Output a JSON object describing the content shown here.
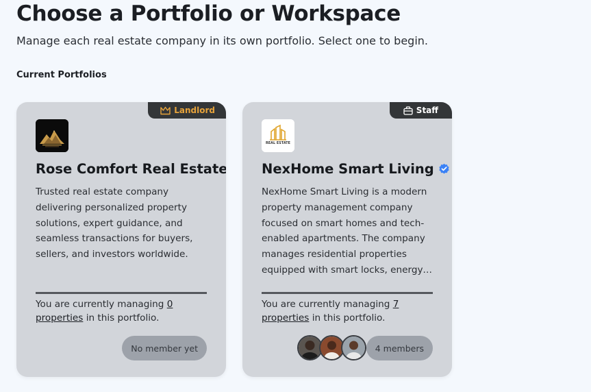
{
  "header": {
    "title": "Choose a Portfolio or Workspace",
    "subtitle": "Manage each real estate company in its own portfolio. Select one to begin."
  },
  "section_label": "Current Portfolios",
  "colors": {
    "page_bg": "#f4f8fd",
    "card_bg": "#d2d5da",
    "badge_bg": "#333638",
    "landlord_accent": "#e7a33b",
    "verified_blue": "#3b82f6",
    "pill_bg": "#9da2aa"
  },
  "portfolios": [
    {
      "role": "Landlord",
      "role_icon": "crown-icon",
      "logo_icon": "mountain-logo-icon",
      "name": "Rose Comfort Real Estate",
      "verified": false,
      "description": "Trusted real estate company delivering personalized property solutions, expert guidance, and seamless transactions for buyers, sellers, and investors worldwide.",
      "managing_prefix": "You are currently managing ",
      "property_count_link": "0 properties",
      "managing_suffix": " in this portfolio.",
      "members_label": "No member yet"
    },
    {
      "role": "Staff",
      "role_icon": "briefcase-icon",
      "logo_icon": "building-logo-icon",
      "logo_text": "REAL ESTATE",
      "name": "NexHome Smart Living",
      "verified": true,
      "description": "NexHome Smart Living is a modern property management company focused on smart homes and tech-enabled apartments. The company manages residential properties equipped with smart locks, energy-efficient systems, and automated maintenance.",
      "managing_prefix": "You are currently managing ",
      "property_count_link": "7 properties",
      "managing_suffix": " in this portfolio.",
      "members_label": "4 members"
    }
  ]
}
